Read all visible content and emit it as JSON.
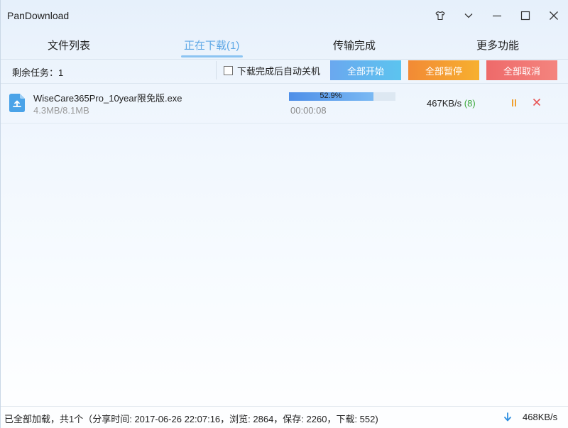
{
  "app": {
    "title": "PanDownload"
  },
  "window_controls": [
    {
      "name": "skin-icon"
    },
    {
      "name": "menu-dropdown-icon"
    },
    {
      "name": "minimize-icon"
    },
    {
      "name": "maximize-icon"
    },
    {
      "name": "close-icon"
    }
  ],
  "tabs": [
    {
      "label": "文件列表",
      "active": false
    },
    {
      "label": "正在下载(1)",
      "active": true
    },
    {
      "label": "传输完成",
      "active": false
    },
    {
      "label": "更多功能",
      "active": false
    }
  ],
  "toolbar": {
    "remaining_tasks": "剩余任务：1",
    "auto_shutdown_label": "下载完成后自动关机",
    "auto_shutdown_checked": false,
    "start_all_label": "全部开始",
    "pause_all_label": "全部暂停",
    "cancel_all_label": "全部取消"
  },
  "downloads": [
    {
      "file_name": "WiseCare365Pro_10year限免版.exe",
      "size_progress": "4.3MB/8.1MB",
      "progress_percent": 52.9,
      "progress_label": "52.9%",
      "elapsed": "00:00:08",
      "speed": "467KB/s",
      "connections": "(8)",
      "icon": "cloud-upload-file-icon"
    }
  ],
  "status": {
    "text": "已全部加载，共1个（分享时间: 2017-06-26 22:07:16，浏览: 2864，保存: 2260，下载: 552)",
    "total_speed": "468KB/s",
    "icon": "download-arrow-icon"
  },
  "colors": {
    "accent_blue": "#5fa8e6",
    "start_button": "#6aa8ef",
    "pause_button": "#f28a35",
    "cancel_button": "#ee6a6a",
    "progress": "#4e8fe8",
    "connections_green": "#3aa83a",
    "pause_icon": "#f0a030",
    "close_icon": "#e85555",
    "download_arrow": "#2f8fe0"
  }
}
